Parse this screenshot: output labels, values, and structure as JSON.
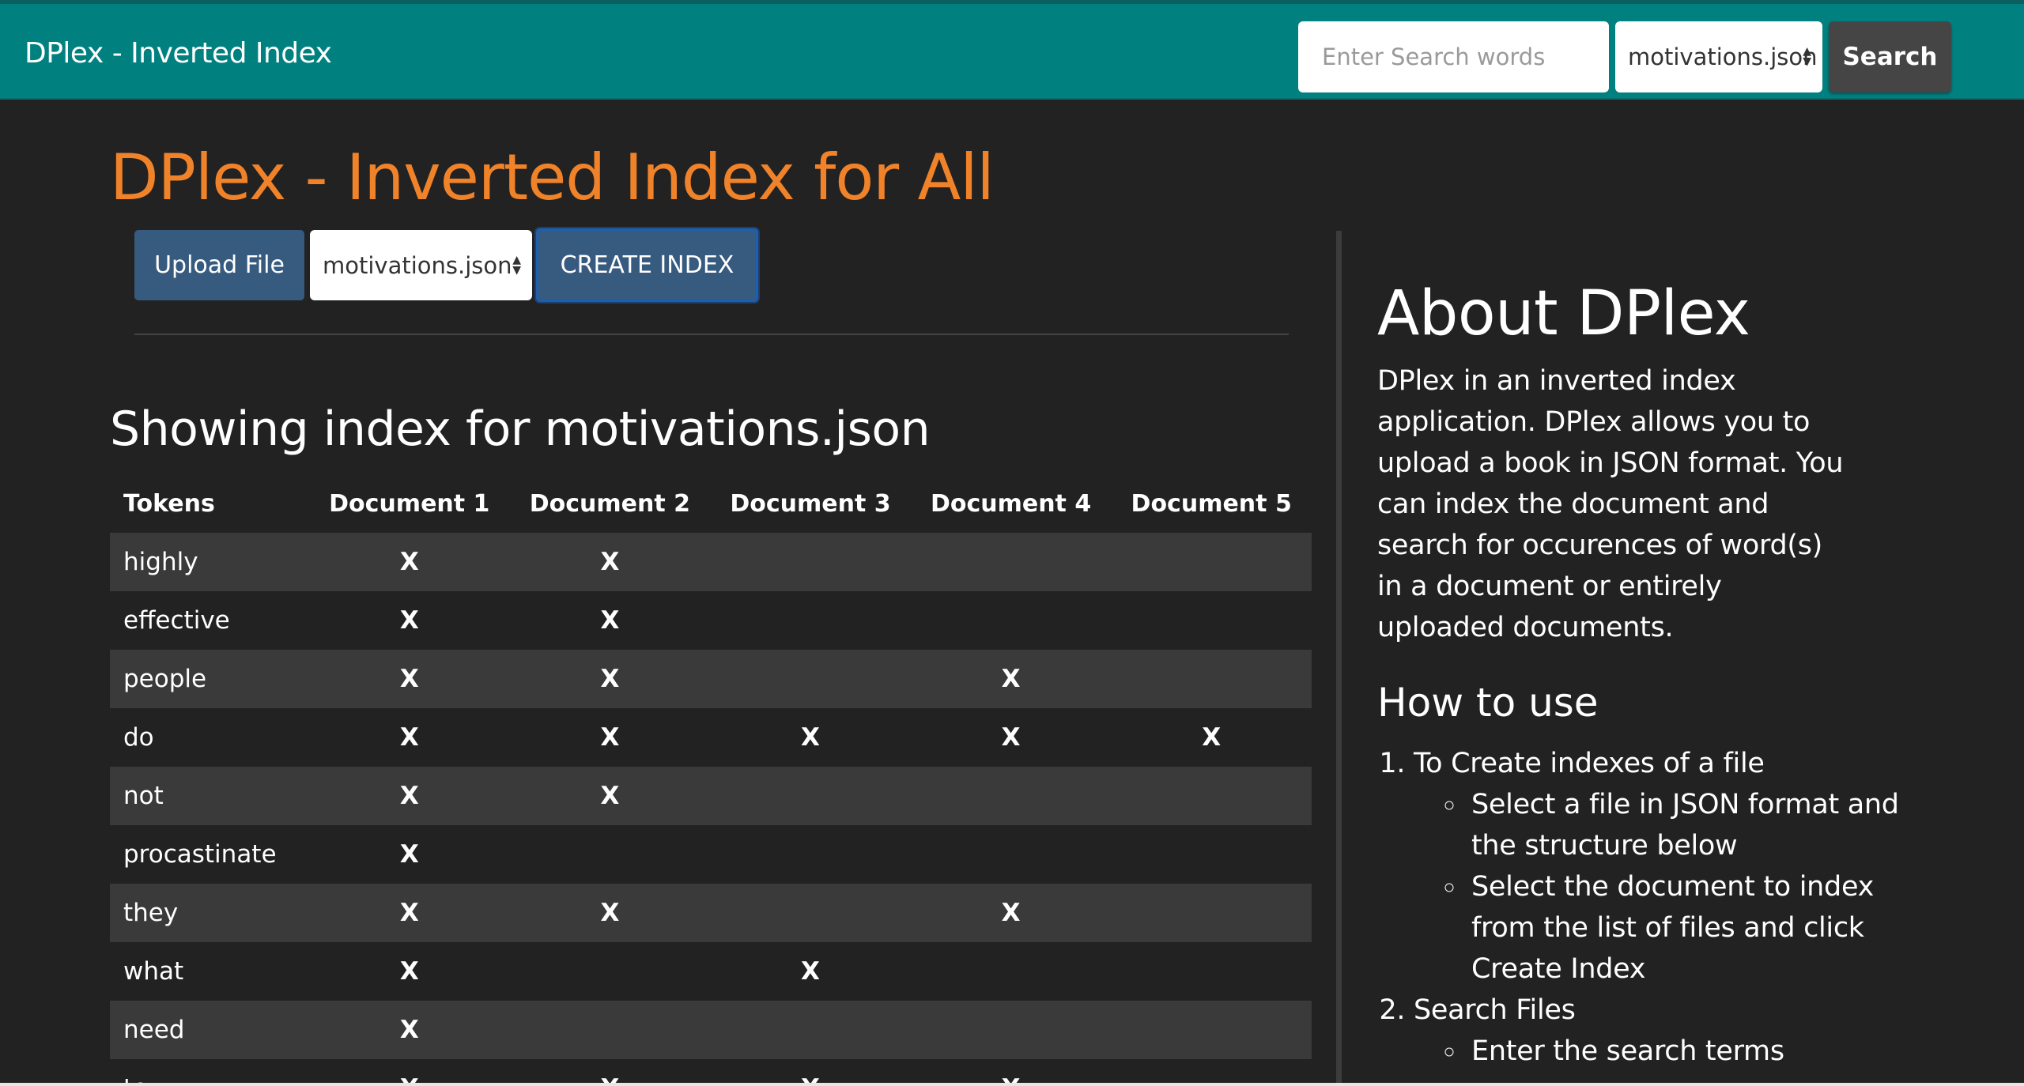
{
  "navbar": {
    "brand": "DPlex - Inverted Index",
    "search_placeholder": "Enter Search words",
    "file_select_value": "motivations.json",
    "search_button": "Search"
  },
  "main": {
    "title": "DPlex - Inverted Index for All",
    "upload_button": "Upload File",
    "file_select_value": "motivations.json",
    "create_button": "CREATE INDEX",
    "subtitle": "Showing index for motivations.json"
  },
  "table": {
    "headers": [
      "Tokens",
      "Document 1",
      "Document 2",
      "Document 3",
      "Document 4",
      "Document 5"
    ],
    "rows": [
      {
        "token": "highly",
        "marks": [
          "X",
          "X",
          "",
          "",
          ""
        ]
      },
      {
        "token": "effective",
        "marks": [
          "X",
          "X",
          "",
          "",
          ""
        ]
      },
      {
        "token": "people",
        "marks": [
          "X",
          "X",
          "",
          "X",
          ""
        ]
      },
      {
        "token": "do",
        "marks": [
          "X",
          "X",
          "X",
          "X",
          "X"
        ]
      },
      {
        "token": "not",
        "marks": [
          "X",
          "X",
          "",
          "",
          ""
        ]
      },
      {
        "token": "procastinate",
        "marks": [
          "X",
          "",
          "",
          "",
          ""
        ]
      },
      {
        "token": "they",
        "marks": [
          "X",
          "X",
          "",
          "X",
          ""
        ]
      },
      {
        "token": "what",
        "marks": [
          "X",
          "",
          "X",
          "",
          ""
        ]
      },
      {
        "token": "need",
        "marks": [
          "X",
          "",
          "",
          "",
          ""
        ]
      },
      {
        "token": "to",
        "marks": [
          "X",
          "X",
          "X",
          "X",
          ""
        ]
      }
    ]
  },
  "about": {
    "title": "About DPlex",
    "text": "DPlex in an inverted index application. DPlex allows you to upload a book in JSON format. You can index the document and search for occurences of word(s) in a document or entirely uploaded documents.",
    "howto_title": "How to use",
    "steps": [
      {
        "label": "To Create indexes of a file",
        "substeps": [
          "Select a file in JSON format and the structure below",
          "Select the document to index from the list of files and click Create Index"
        ]
      },
      {
        "label": "Search Files",
        "substeps": [
          "Enter the search terms"
        ]
      }
    ]
  },
  "colors": {
    "navbar": "#018080",
    "accent_orange": "#f0832a",
    "button_blue": "#375a7f",
    "background": "#222222",
    "row_stripe": "#3a3a3a"
  }
}
